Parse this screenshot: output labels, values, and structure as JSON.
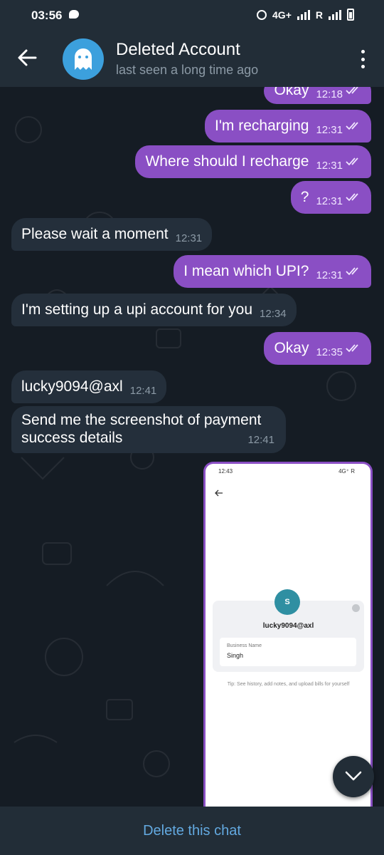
{
  "status_bar": {
    "time": "03:56",
    "network": "4G+",
    "roaming": "R"
  },
  "header": {
    "name": "Deleted Account",
    "status": "last seen a long time ago"
  },
  "messages": [
    {
      "text": "Okay",
      "time": "12:18",
      "outgoing": true
    },
    {
      "text": "I'm recharging",
      "time": "12:31",
      "outgoing": true
    },
    {
      "text": "Where should I recharge",
      "time": "12:31",
      "outgoing": true
    },
    {
      "text": "?",
      "time": "12:31",
      "outgoing": true
    },
    {
      "text": "Please wait a moment",
      "time": "12:31",
      "outgoing": false
    },
    {
      "text": "I mean which UPI?",
      "time": "12:31",
      "outgoing": true
    },
    {
      "text": "I'm setting up a upi account for you",
      "time": "12:34",
      "outgoing": false
    },
    {
      "text": "Okay",
      "time": "12:35",
      "outgoing": true
    },
    {
      "text": "lucky9094@axl",
      "time": "12:41",
      "outgoing": false
    },
    {
      "text_line1": "Send me the screenshot of payment",
      "text_line2": "success details",
      "time": "12:41",
      "outgoing": false
    }
  ],
  "screenshot_image": {
    "status_time": "12:43",
    "status_right": "4G⁺ R",
    "avatar_letter": "S",
    "upi_id": "lucky9094@axl",
    "field_label": "Business Name",
    "field_value": "Singh",
    "tip": "Tip: See history, add notes, and upload bills for yourself"
  },
  "bottom_bar": {
    "delete_label": "Delete this chat"
  },
  "colors": {
    "outgoing_bubble": "#8a4fc4",
    "incoming_bubble": "#242f3b",
    "header": "#222d37",
    "background": "#151c24",
    "link": "#63a9e0"
  }
}
